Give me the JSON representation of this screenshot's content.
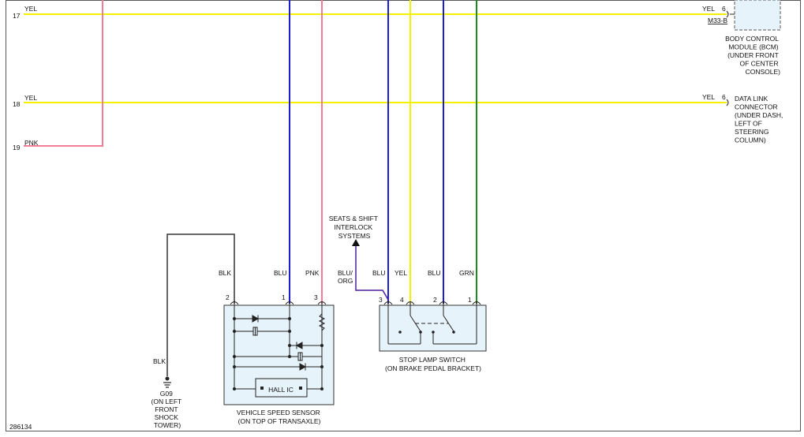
{
  "colors": {
    "yellow": "#f2f200",
    "pink": "#f27b97",
    "blue": "#1c1cd0",
    "green": "#1a8c1a",
    "black": "#333333",
    "purple": "#4b1fa0",
    "component_fill": "#e6f3fb",
    "component_stroke": "#333333",
    "frame": "#555555"
  },
  "left_wires": [
    {
      "num": "17",
      "color_label": "YEL"
    },
    {
      "num": "18",
      "color_label": "YEL"
    },
    {
      "num": "19",
      "color_label": "PNK"
    }
  ],
  "bcm": {
    "wire_label": "YEL",
    "pin": "6",
    "connector_id": "M33-B",
    "label_lines": [
      "BODY CONTROL",
      "MODULE (BCM)",
      "(UNDER FRONT",
      "OF CENTER",
      "CONSOLE)"
    ]
  },
  "dlc": {
    "wire_label": "YEL",
    "pin": "6",
    "label_lines": [
      "DATA LINK",
      "CONNECTOR",
      "(UNDER DASH,",
      "LEFT OF",
      "STEERING",
      "COLUMN)"
    ]
  },
  "seats_label_lines": [
    "SEATS & SHIFT",
    "INTERLOCK",
    "SYSTEMS"
  ],
  "ground": {
    "wire_label": "BLK",
    "label_lines": [
      "G09",
      "(ON LEFT",
      "FRONT",
      "SHOCK",
      "TOWER)"
    ]
  },
  "vss": {
    "pins": [
      {
        "num": "2",
        "wire": "BLK"
      },
      {
        "num": "1",
        "wire": "BLU"
      },
      {
        "num": "3",
        "wire": "PNK"
      }
    ],
    "ic_label": "HALL IC",
    "label_lines": [
      "VEHICLE SPEED SENSOR",
      "(ON TOP OF TRANSAXLE)"
    ]
  },
  "stop_lamp": {
    "pins": [
      {
        "num": "3",
        "wire": "BLU"
      },
      {
        "num": "4",
        "wire": "YEL"
      },
      {
        "num": "2",
        "wire": "BLU"
      },
      {
        "num": "1",
        "wire": "GRN"
      }
    ],
    "extra_wire_label_lines": [
      "BLU/",
      "ORG"
    ],
    "label_lines": [
      "STOP LAMP SWITCH",
      "(ON BRAKE PEDAL BRACKET)"
    ]
  },
  "figure_id": "286134"
}
